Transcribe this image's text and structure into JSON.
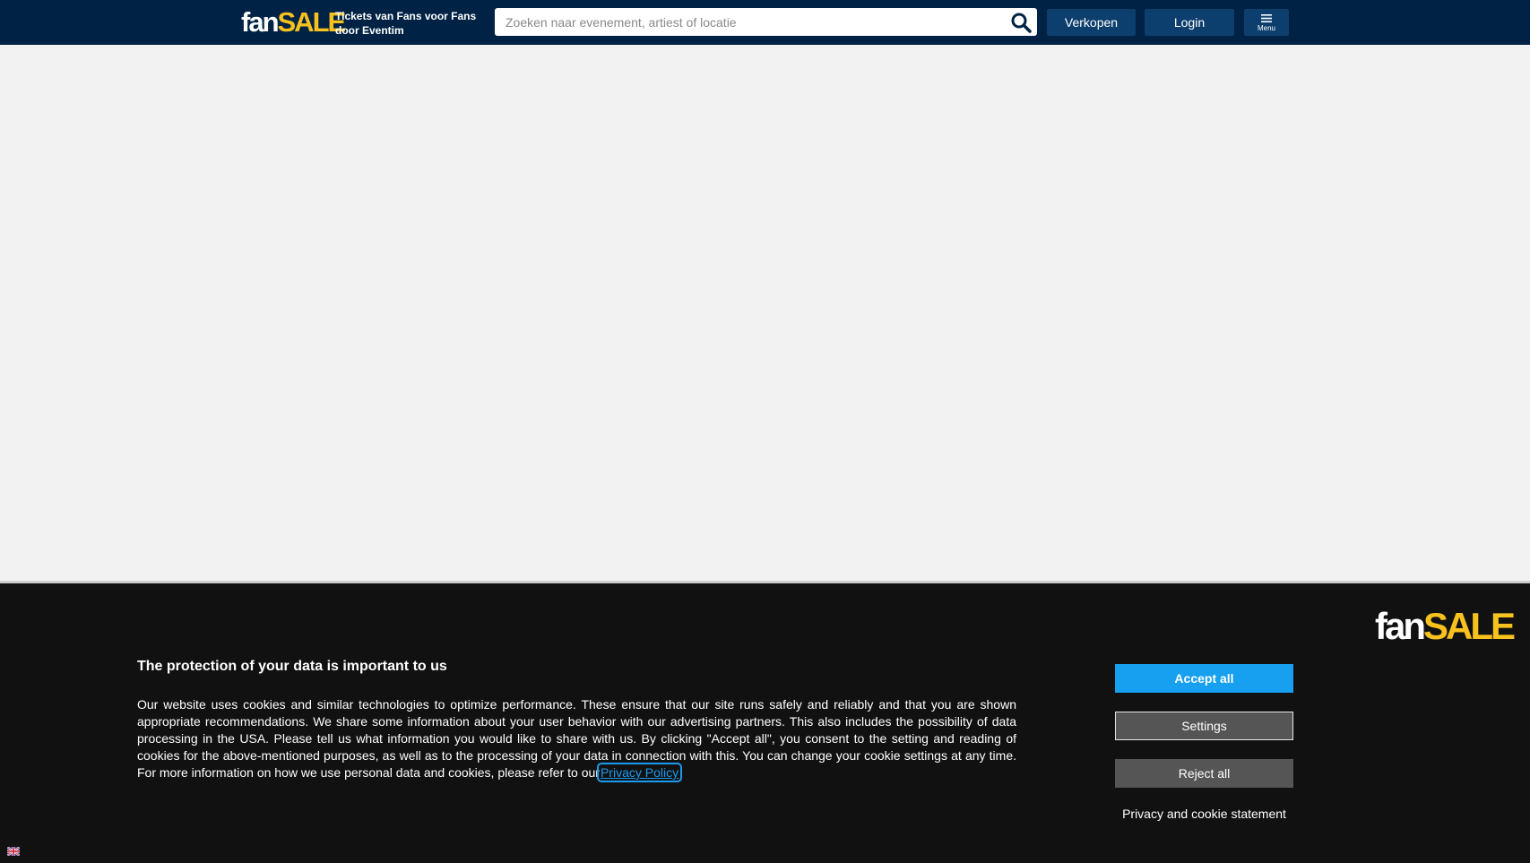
{
  "header": {
    "logo": {
      "fan": "fan",
      "sale": "SALE"
    },
    "tagline": "Tickets van Fans voor Fans door Eventim",
    "search": {
      "placeholder": "Zoeken naar evenement, artiest of locatie",
      "value": ""
    },
    "sell_label": "Verkopen",
    "login_label": "Login",
    "menu_label": "Menu"
  },
  "cookie_banner": {
    "logo": {
      "fan": "fan",
      "sale": "SALE"
    },
    "title": "The protection of your data is important to us",
    "body": "Our website uses cookies and similar technologies to optimize performance. These ensure that our site runs safely and reliably and that you are shown appropriate recommendations. We share some information about your user behavior with our advertising partners. This also includes the possibility of data processing in the USA. Please tell us what information you would like to share with us. By clicking \"Accept all\", you consent to the setting and reading of cookies for the above-mentioned purposes, as well as to the processing of your data in connection with this. You can change your cookie settings at any time. For more information on how we use personal data and cookies, please refer to our",
    "privacy_link": "Privacy Policy",
    "after_link": ".",
    "accept_label": "Accept all",
    "settings_label": "Settings",
    "reject_label": "Reject all",
    "statement_label": "Privacy and cookie statement",
    "language_icon": "uk-flag-icon"
  },
  "colors": {
    "header_bg": "#002244",
    "header_button": "#0d3f6e",
    "logo_accent": "#f7c11e",
    "accept_button": "#179ff0",
    "secondary_button": "#555555",
    "banner_bg": "#111111",
    "page_bg": "#f2f2f2"
  }
}
